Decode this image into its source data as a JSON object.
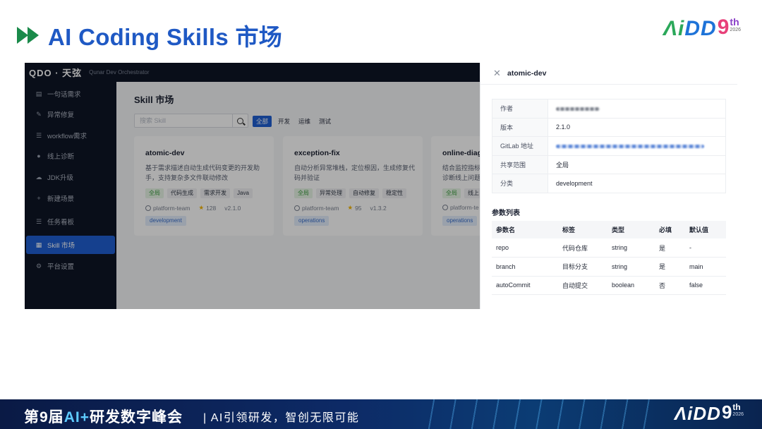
{
  "slide": {
    "title": "AI Coding Skills 市场",
    "brand": {
      "a": "Λi",
      "dd": "DD",
      "nine": "9",
      "th": "th",
      "year": "2026"
    }
  },
  "app": {
    "logo": "QDO · 天弦",
    "subtitle": "Qunar Dev Orchestrator",
    "sidebar": [
      {
        "icon": "chat-icon",
        "glyph": "▤",
        "label": "一句话需求"
      },
      {
        "icon": "wrench-icon",
        "glyph": "✎",
        "label": "异常修复"
      },
      {
        "icon": "list-icon",
        "glyph": "☰",
        "label": "workflow需求"
      },
      {
        "icon": "search-icon",
        "glyph": "●",
        "label": "线上诊断"
      },
      {
        "icon": "cloud-icon",
        "glyph": "☁",
        "label": "JDK升级"
      },
      {
        "icon": "plus-icon",
        "glyph": "+",
        "label": "新建场景"
      },
      {
        "icon": "kanban-icon",
        "glyph": "☰",
        "label": "任务看板"
      },
      {
        "icon": "grid-icon",
        "glyph": "▦",
        "label": "Skill 市场"
      },
      {
        "icon": "gear-icon",
        "glyph": "⚙",
        "label": "平台设置"
      }
    ],
    "main": {
      "title": "Skill 市场",
      "search_placeholder": "搜索 Skill",
      "filters": [
        "全部",
        "开发",
        "运维",
        "测试"
      ],
      "cards": [
        {
          "title": "atomic-dev",
          "desc": "基于需求描述自动生成代码变更的开发助手，支持复杂多文件联动修改",
          "tags": [
            "全局",
            "代码生成",
            "需求开发",
            "Java"
          ],
          "author": "platform-team",
          "stars": "128",
          "version": "v2.1.0",
          "category": "development"
        },
        {
          "title": "exception-fix",
          "desc": "自动分析异常堆栈，定位根因，生成修复代码并验证",
          "tags": [
            "全局",
            "异常处理",
            "自动修复",
            "稳定性"
          ],
          "author": "platform-team",
          "stars": "95",
          "version": "v1.3.2",
          "category": "operations"
        },
        {
          "title": "online-diag",
          "desc": "结合监控指标诊断线上问题",
          "tags": [
            "全局",
            "线上"
          ],
          "author": "platform-te",
          "stars": "",
          "version": "",
          "category": "operations"
        }
      ]
    },
    "drawer": {
      "title": "atomic-dev",
      "fields": [
        {
          "key": "作者",
          "value": ""
        },
        {
          "key": "版本",
          "value": "2.1.0"
        },
        {
          "key": "GitLab 地址",
          "value": ""
        },
        {
          "key": "共享范围",
          "value": "全局"
        },
        {
          "key": "分类",
          "value": "development"
        }
      ],
      "params_title": "参数列表",
      "params_headers": [
        "参数名",
        "标签",
        "类型",
        "必填",
        "默认值"
      ],
      "params_rows": [
        [
          "repo",
          "代码仓库",
          "string",
          "是",
          "-"
        ],
        [
          "branch",
          "目标分支",
          "string",
          "是",
          "main"
        ],
        [
          "autoCommit",
          "自动提交",
          "boolean",
          "否",
          "false"
        ]
      ]
    }
  },
  "footer": {
    "prefix": "第9届",
    "ai": "AI+",
    "suffix": "研发数字峰会",
    "sub": "| AI引领研发，智创无限可能"
  },
  "colors": {
    "accent": "#1f5fd1",
    "title": "#1f59c4",
    "sidebar": "#0e1626"
  }
}
